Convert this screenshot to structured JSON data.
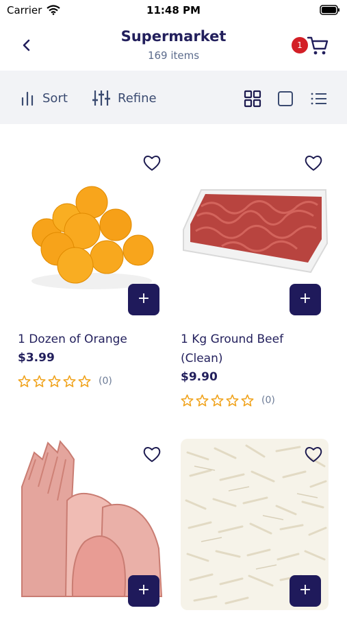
{
  "status_bar": {
    "carrier": "Carrier",
    "time": "11:48 PM"
  },
  "header": {
    "title": "Supermarket",
    "subtitle": "169 items",
    "cart_count": "1"
  },
  "toolbar": {
    "sort_label": "Sort",
    "refine_label": "Refine"
  },
  "products": [
    {
      "name": "1 Dozen of Orange",
      "price": "$3.99",
      "rating_count": "(0)",
      "stars": 0
    },
    {
      "name": "1 Kg Ground Beef (Clean)",
      "price": "$9.90",
      "rating_count": "(0)",
      "stars": 0
    },
    {
      "name": "",
      "price": "",
      "rating_count": "",
      "stars": 0
    },
    {
      "name": "",
      "price": "",
      "rating_count": "",
      "stars": 0
    }
  ],
  "add_label": "+",
  "colors": {
    "accent": "#1f1a5b",
    "badge": "#d31f26",
    "star": "#f0a21a",
    "toolbar_bg": "#f2f3f6"
  },
  "icons": [
    "back-arrow-icon",
    "cart-icon",
    "sort-icon",
    "refine-icon",
    "grid-view-icon",
    "single-view-icon",
    "list-view-icon",
    "heart-icon",
    "star-icon"
  ]
}
